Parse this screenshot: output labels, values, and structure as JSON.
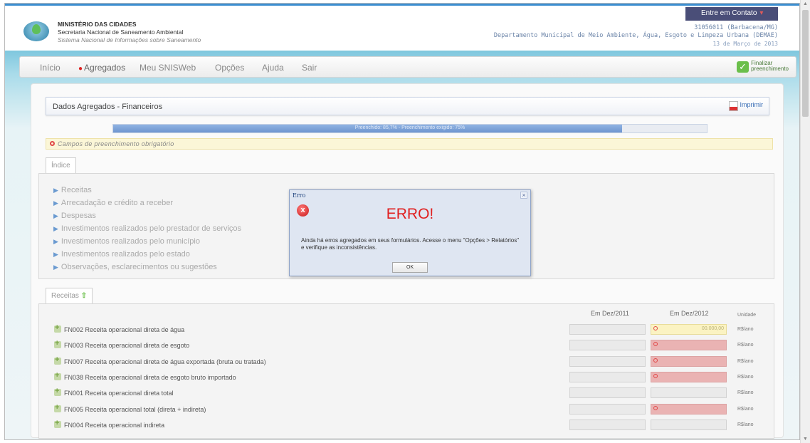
{
  "header": {
    "org_line1": "MINISTÉRIO DAS CIDADES",
    "org_line2": "Secretaria Nacional de Saneamento Ambiental",
    "org_line3": "Sistema Nacional de Informações sobre Saneamento",
    "contact_label": "Entre em Contato",
    "muni_code": "31056011 (Barbacena/MG)",
    "muni_dept": "Departamento Municipal de Meio Ambiente, Água, Esgoto e Limpeza Urbana (DEMAE)",
    "date": "13 de Março de 2013"
  },
  "nav": {
    "items": [
      "Início",
      "Agregados",
      "Meu SNISWeb",
      "Opções",
      "Ajuda",
      "Sair"
    ],
    "finalize_line1": "Finalizar",
    "finalize_line2": "preenchimento"
  },
  "page": {
    "title": "Dados Agregados - Financeiros",
    "print_label": "Imprimir",
    "progress_text": "Preenchido: 85,7% - Preenchimento exigido: 75%",
    "progress_fraction": 0.857,
    "required_note": "Campos de preenchimento obrigatório"
  },
  "index": {
    "tab_label": "Índice",
    "links": [
      "Receitas",
      "Arrecadação e crédito a receber",
      "Despesas",
      "Investimentos realizados pelo prestador de serviços",
      "Investimentos realizados pelo município",
      "Investimentos realizados pelo estado",
      "Observações, esclarecimentos ou sugestões"
    ]
  },
  "receitas": {
    "tab_label": "Receitas",
    "col_2011": "Em Dez/2011",
    "col_2012": "Em Dez/2012",
    "col_unit": "Unidade",
    "rows": [
      {
        "label": "FN002 Receita operacional direta de água",
        "value_2012": "00.000,00",
        "unit": "R$/ano"
      },
      {
        "label": "FN003 Receita operacional direta de esgoto",
        "unit": "R$/ano"
      },
      {
        "label": "FN007 Receita operacional direta de água exportada (bruta ou tratada)",
        "unit": "R$/ano"
      },
      {
        "label": "FN038 Receita operacional direta de esgoto bruto importado",
        "unit": "R$/ano"
      },
      {
        "label": "FN001 Receita operacional direta total",
        "unit": "R$/ano"
      },
      {
        "label": "FN005 Receita operacional total (direta + indireta)",
        "unit": "R$/ano"
      },
      {
        "label": "FN004 Receita operacional indireta",
        "unit": "R$/ano"
      }
    ]
  },
  "modal": {
    "title": "Erro",
    "close": "×",
    "icon": "x",
    "heading": "ERRO!",
    "message": "Ainda há erros agregados em seus formulários. Acesse o menu \"Opções > Relatórios\" e verifique as inconsistências.",
    "ok_label": "OK"
  },
  "colors": {
    "accent": "#3d8fd1",
    "error": "#e02020",
    "error_cell": "#eab3b3",
    "warn_cell": "#fbf3c2"
  }
}
